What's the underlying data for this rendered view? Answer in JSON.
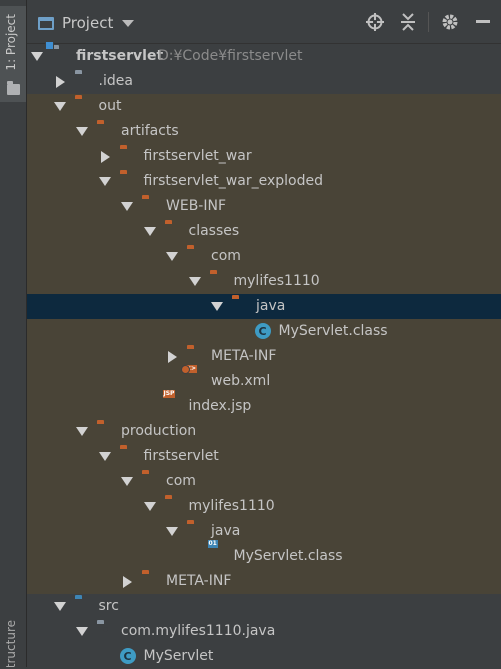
{
  "side_strip": {
    "project_tab": "1: Project",
    "structure_tab": "Structure"
  },
  "header": {
    "title": "Project",
    "toolbar_icons": [
      "locate-icon",
      "collapse-all-icon",
      "settings-icon",
      "hide-icon"
    ]
  },
  "colors": {
    "background": "#3c3f41",
    "excluded": "#494437",
    "selected": "#0d293e",
    "folder_orange": "#c1602c",
    "folder_blue": "#3e85b4"
  },
  "tree": [
    {
      "label": "firstservlet",
      "hint": "D:¥Code¥firstservlet",
      "level": 0,
      "expanded": true,
      "icon": "module-folder-icon"
    },
    {
      "label": ".idea",
      "level": 1,
      "expanded": false,
      "icon": "folder-grey-icon"
    },
    {
      "label": "out",
      "level": 1,
      "expanded": true,
      "icon": "folder-orange-icon"
    },
    {
      "label": "artifacts",
      "level": 2,
      "expanded": true,
      "icon": "folder-orange-icon"
    },
    {
      "label": "firstservlet_war",
      "level": 3,
      "expanded": false,
      "icon": "folder-orange-icon"
    },
    {
      "label": "firstservlet_war_exploded",
      "level": 3,
      "expanded": true,
      "icon": "folder-orange-icon"
    },
    {
      "label": "WEB-INF",
      "level": 4,
      "expanded": true,
      "icon": "folder-orange-icon"
    },
    {
      "label": "classes",
      "level": 5,
      "expanded": true,
      "icon": "folder-orange-icon"
    },
    {
      "label": "com",
      "level": 6,
      "expanded": true,
      "icon": "folder-orange-icon"
    },
    {
      "label": "mylifes1110",
      "level": 7,
      "expanded": true,
      "icon": "folder-orange-icon"
    },
    {
      "label": "java",
      "level": 8,
      "expanded": true,
      "icon": "folder-orange-icon",
      "selected": true
    },
    {
      "label": "MyServlet.class",
      "level": 9,
      "icon": "class-icon"
    },
    {
      "label": "META-INF",
      "level": 6,
      "expanded": false,
      "icon": "folder-orange-icon"
    },
    {
      "label": "web.xml",
      "level": 6,
      "icon": "xml-file-icon"
    },
    {
      "label": "index.jsp",
      "level": 5,
      "icon": "jsp-file-icon"
    },
    {
      "label": "production",
      "level": 2,
      "expanded": true,
      "icon": "folder-orange-icon"
    },
    {
      "label": "firstservlet",
      "level": 3,
      "expanded": true,
      "icon": "folder-orange-icon"
    },
    {
      "label": "com",
      "level": 4,
      "expanded": true,
      "icon": "folder-orange-icon"
    },
    {
      "label": "mylifes1110",
      "level": 5,
      "expanded": true,
      "icon": "folder-orange-icon"
    },
    {
      "label": "java",
      "level": 6,
      "expanded": true,
      "icon": "folder-orange-icon"
    },
    {
      "label": "MyServlet.class",
      "level": 7,
      "icon": "compiled-class-icon"
    },
    {
      "label": "META-INF",
      "level": 4,
      "expanded": false,
      "icon": "folder-orange-icon"
    },
    {
      "label": "src",
      "level": 1,
      "expanded": true,
      "icon": "folder-blue-icon"
    },
    {
      "label": "com.mylifes1110.java",
      "level": 2,
      "expanded": true,
      "icon": "package-icon"
    },
    {
      "label": "MyServlet",
      "level": 3,
      "icon": "class-icon"
    }
  ]
}
